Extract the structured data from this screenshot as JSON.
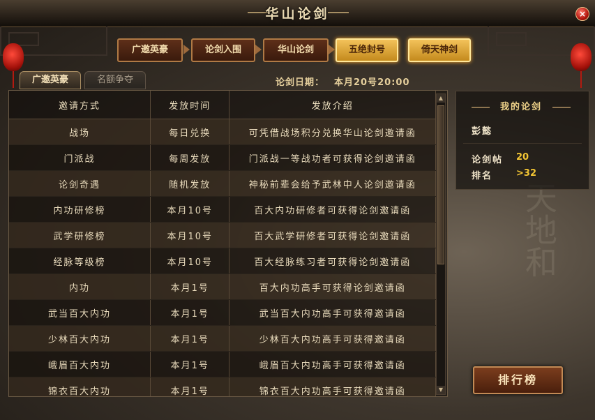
{
  "window": {
    "title": "华山论剑",
    "close": "×"
  },
  "steps": [
    "广邀英豪",
    "论剑入围",
    "华山论剑",
    "五绝封号",
    "倚天神剑"
  ],
  "tabs": [
    "广邀英豪",
    "名额争夺"
  ],
  "date": {
    "label": "论剑日期：",
    "value": "本月20号20:00"
  },
  "table": {
    "headers": [
      "邀请方式",
      "发放时间",
      "发放介绍"
    ],
    "rows": [
      [
        "战场",
        "每日兑换",
        "可凭借战场积分兑换华山论剑邀请函"
      ],
      [
        "门派战",
        "每周发放",
        "门派战一等战功者可获得论剑邀请函"
      ],
      [
        "论剑奇遇",
        "随机发放",
        "神秘前辈会给予武林中人论剑邀请函"
      ],
      [
        "内功研修榜",
        "本月10号",
        "百大内功研修者可获得论剑邀请函"
      ],
      [
        "武学研修榜",
        "本月10号",
        "百大武学研修者可获得论剑邀请函"
      ],
      [
        "经脉等级榜",
        "本月10号",
        "百大经脉练习者可获得论剑邀请函"
      ],
      [
        "内功",
        "本月1号",
        "百大内功高手可获得论剑邀请函"
      ],
      [
        "武当百大内功",
        "本月1号",
        "武当百大内功高手可获得邀请函"
      ],
      [
        "少林百大内功",
        "本月1号",
        "少林百大内功高手可获得邀请函"
      ],
      [
        "峨眉百大内功",
        "本月1号",
        "峨眉百大内功高手可获得邀请函"
      ],
      [
        "锦衣百大内功",
        "本月1号",
        "锦衣百大内功高手可获得邀请函"
      ]
    ]
  },
  "my_panel": {
    "title": "我的论剑",
    "name": "彭懿",
    "tickets_label": "论剑帖",
    "tickets_value": "20",
    "rank_label": "排名",
    "rank_value": ">32"
  },
  "rank_button": "排行榜",
  "colors": {
    "gold_text": "#f3c534",
    "active_step": "#f3c25a",
    "dark_step": "#5e2f19",
    "lantern": "#c01a10"
  }
}
